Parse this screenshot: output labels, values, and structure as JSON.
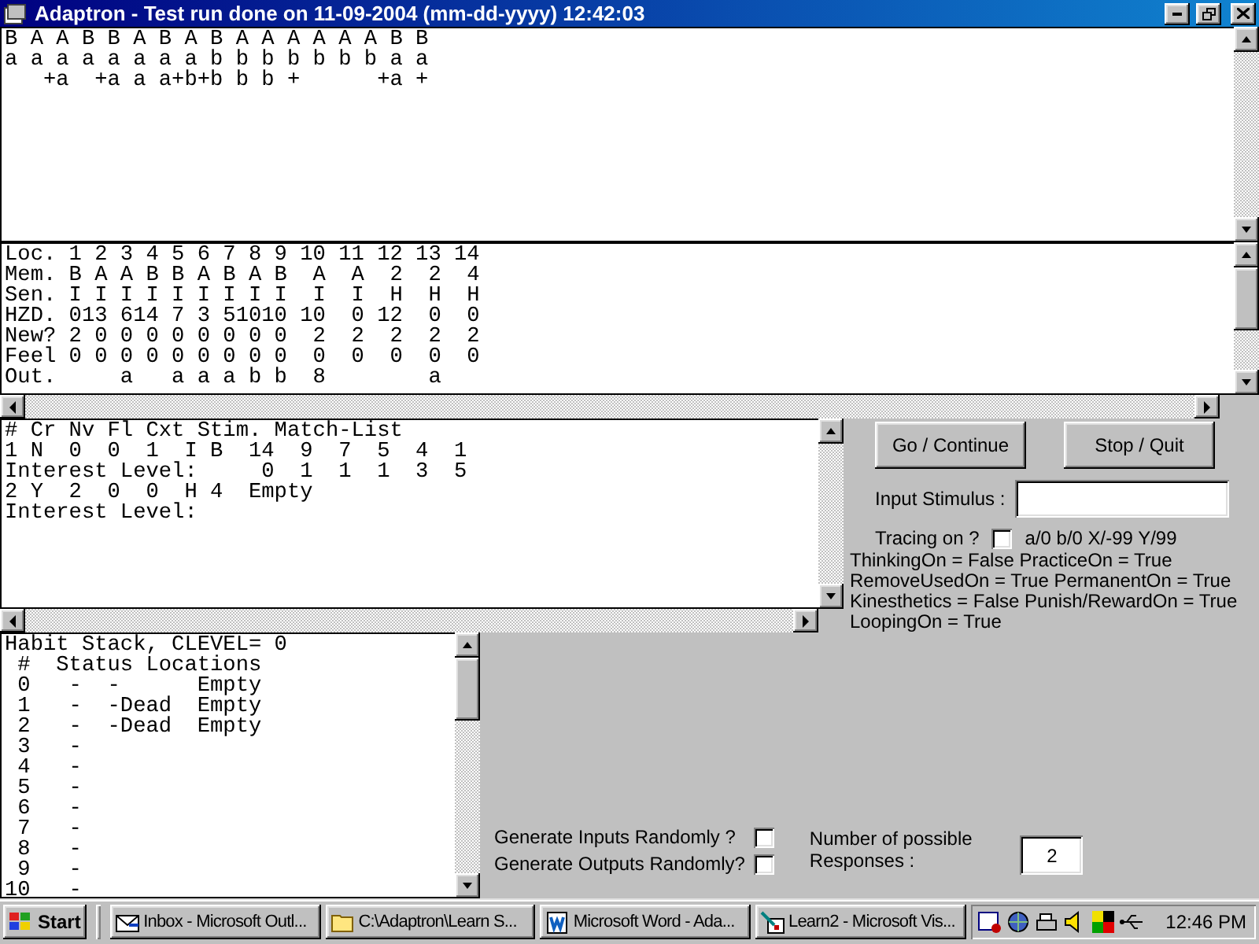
{
  "window": {
    "title": "Adaptron - Test run done on 11-09-2004 (mm-dd-yyyy) 12:42:03"
  },
  "sequence_box": {
    "lines": [
      "B A A B B A B A B A A A A A A B B",
      "a a a a a a a a b b b b b b b a a",
      "   +a  +a a a+b+b b b +      +a +"
    ]
  },
  "memory_box": {
    "lines": [
      "Loc. 1 2 3 4 5 6 7 8 9 10 11 12 13 14",
      "Mem. B A A B B A B A B  A  A  2  2  4",
      "Sen. I I I I I I I I I  I  I  H  H  H",
      "HZD. 013 614 7 3 51010 10  0 12  0  0",
      "New? 2 0 0 0 0 0 0 0 0  2  2  2  2  2",
      "Feel 0 0 0 0 0 0 0 0 0  0  0  0  0  0",
      "Out.     a   a a a b b  8        a"
    ]
  },
  "match_box": {
    "lines": [
      "# Cr Nv Fl Cxt Stim. Match-List",
      "1 N  0  0  1  I B  14  9  7  5  4  1",
      "Interest Level:     0  1  1  1  3  5",
      "2 Y  2  0  0  H 4  Empty",
      "Interest Level:"
    ]
  },
  "habit_box": {
    "lines": [
      "Habit Stack, CLEVEL= 0",
      " #  Status Locations",
      " 0   -  -      Empty",
      " 1   -  -Dead  Empty",
      " 2   -  -Dead  Empty",
      " 3   -",
      " 4   -",
      " 5   -",
      " 6   -",
      " 7   -",
      " 8   -",
      " 9   -",
      "10   -"
    ]
  },
  "controls": {
    "go_button": "Go / Continue",
    "stop_button": "Stop / Quit",
    "input_label": "Input Stimulus :",
    "tracing": {
      "label": "Tracing on ?",
      "checked": false
    },
    "legend": "a/0  b/0  X/-99  Y/99",
    "flags": [
      "ThinkingOn = False PracticeOn = True",
      "RemoveUsedOn = True PermanentOn = True",
      "Kinesthetics = False Punish/RewardOn = True",
      "LoopingOn = True"
    ]
  },
  "random": {
    "options": [
      {
        "label": "Generate Inputs Randomly ?",
        "checked": false
      },
      {
        "label": "Generate Outputs Randomly?",
        "checked": false
      }
    ],
    "responses_label": "Number of possible Responses :",
    "responses_value": "2"
  },
  "taskbar": {
    "start": "Start",
    "tasks": [
      {
        "kind": "mail",
        "label": "Inbox - Microsoft Outl..."
      },
      {
        "kind": "folder",
        "label": "C:\\Adaptron\\Learn S..."
      },
      {
        "kind": "document",
        "label": "Microsoft Word - Ada..."
      },
      {
        "kind": "tools",
        "label": "Learn2 - Microsoft Vis..."
      }
    ],
    "clock": "12:46 PM"
  }
}
